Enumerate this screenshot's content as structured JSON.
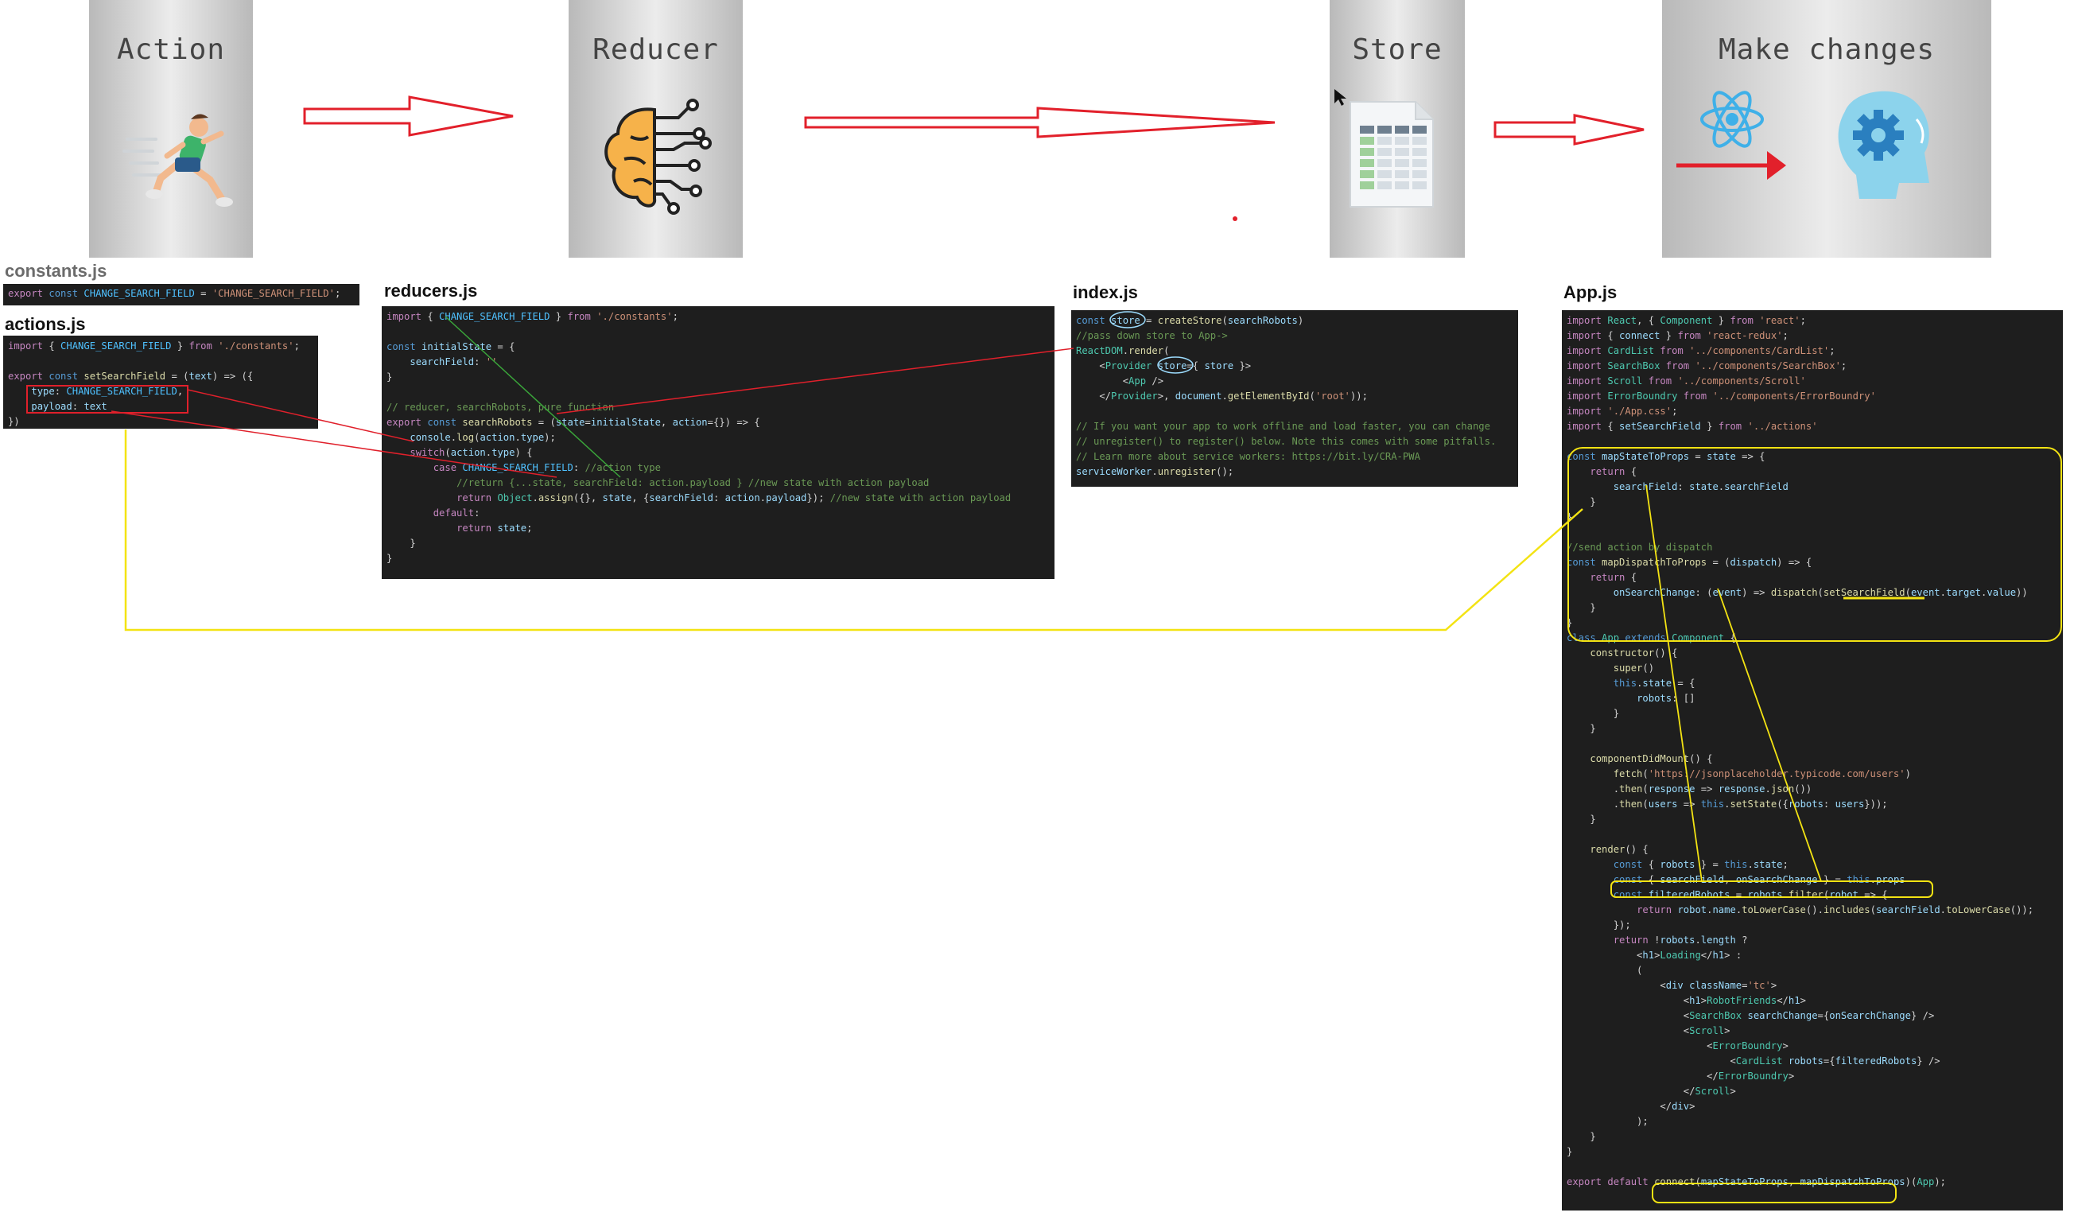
{
  "stages": [
    {
      "id": "action",
      "title": "Action",
      "icon": "running-man-icon"
    },
    {
      "id": "reducer",
      "title": "Reducer",
      "icon": "brain-circuit-icon"
    },
    {
      "id": "store",
      "title": "Store",
      "icon": "spreadsheet-document-icon"
    },
    {
      "id": "make-changes",
      "title": "Make changes",
      "icon": "react-gear-head-icon"
    }
  ],
  "files": {
    "constants": {
      "label": "constants.js",
      "lines": [
        "export const CHANGE_SEARCH_FIELD = 'CHANGE_SEARCH_FIELD';"
      ]
    },
    "actions": {
      "label": "actions.js",
      "lines": [
        "import { CHANGE_SEARCH_FIELD } from './constants';",
        "",
        "export const setSearchField = (text) => ({",
        "    type: CHANGE_SEARCH_FIELD,",
        "    payload: text",
        "})"
      ]
    },
    "reducers": {
      "label": "reducers.js",
      "lines": [
        "import { CHANGE_SEARCH_FIELD } from './constants';",
        "",
        "const initialState = {",
        "    searchField: ''",
        "}",
        "",
        "// reducer, searchRobots, pure function",
        "export const searchRobots = (state=initialState, action={}) => {",
        "    console.log(action.type);",
        "    switch(action.type) {",
        "        case CHANGE_SEARCH_FIELD: //action type",
        "            //return {...state, searchField: action.payload } //new state with action payload",
        "            return Object.assign({}, state, {searchField: action.payload}); //new state with action payload",
        "        default:",
        "            return state;",
        "    }",
        "}"
      ]
    },
    "index": {
      "label": "index.js",
      "lines": [
        "const store = createStore(searchRobots)",
        "//pass down store to App->",
        "ReactDOM.render(",
        "    <Provider store={ store }>",
        "        <App />",
        "    </Provider>, document.getElementById('root'));",
        "",
        "// If you want your app to work offline and load faster, you can change",
        "// unregister() to register() below. Note this comes with some pitfalls.",
        "// Learn more about service workers: https://bit.ly/CRA-PWA",
        "serviceWorker.unregister();"
      ]
    },
    "app": {
      "label": "App.js",
      "lines": [
        "import React, { Component } from 'react';",
        "import { connect } from 'react-redux';",
        "import CardList from '../components/CardList';",
        "import SearchBox from '../components/SearchBox';",
        "import Scroll from '../components/Scroll'",
        "import ErrorBoundry from '../components/ErrorBoundry'",
        "import './App.css';",
        "import { setSearchField } from '../actions'",
        "",
        "const mapStateToProps = state => {",
        "    return {",
        "        searchField: state.searchField",
        "    }",
        "}",
        "",
        "//send action by dispatch",
        "const mapDispatchToProps = (dispatch) => {",
        "    return {",
        "        onSearchChange: (event) => dispatch(setSearchField(event.target.value))",
        "    }",
        "}",
        "class App extends Component {",
        "    constructor() {",
        "        super()",
        "        this.state = {",
        "            robots: []",
        "        }",
        "    }",
        "",
        "    componentDidMount() {",
        "        fetch('https://jsonplaceholder.typicode.com/users')",
        "        .then(response => response.json())",
        "        .then(users => this.setState({robots: users}));",
        "    }",
        "",
        "    render() {",
        "        const { robots } = this.state;",
        "        const { searchField, onSearchChange } = this.props",
        "        const filteredRobots = robots.filter(robot => {",
        "            return robot.name.toLowerCase().includes(searchField.toLowerCase());",
        "        });",
        "        return !robots.length ?",
        "            <h1>Loading</h1> :",
        "            (",
        "                <div className='tc'>",
        "                    <h1>RobotFriends</h1>",
        "                    <SearchBox searchChange={onSearchChange} />",
        "                    <Scroll>",
        "                        <ErrorBoundry>",
        "                            <CardList robots={filteredRobots} />",
        "                        </ErrorBoundry>",
        "                    </Scroll>",
        "                </div>",
        "            );",
        "    }",
        "}",
        "",
        "export default connect(mapStateToProps, mapDispatchToProps)(App);"
      ]
    }
  },
  "colors": {
    "flow_arrow": "#e2202b",
    "highlight_yellow": "#f3e313",
    "highlight_red": "#e0202b",
    "highlight_green": "#3aa53a",
    "code_bg": "#1e1e1e"
  }
}
